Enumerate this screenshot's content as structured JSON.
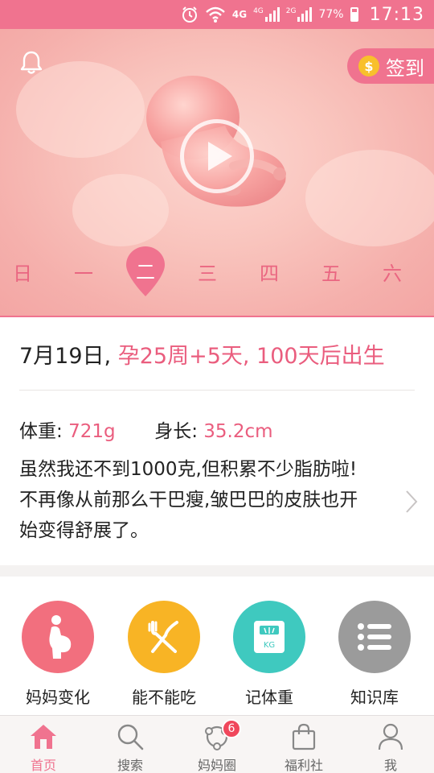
{
  "status_bar": {
    "network_1": "4G",
    "network_2": "4G",
    "network_3": "2G",
    "battery": "77%",
    "time": "17:13"
  },
  "hero": {
    "signin_label": "签到",
    "weekdays": [
      "日",
      "一",
      "二",
      "三",
      "四",
      "五",
      "六"
    ],
    "selected_day": "二"
  },
  "info": {
    "date": "7月19日,",
    "pregnancy": "孕25周+5天, 100天后出生",
    "weight_label": "体重:",
    "weight_value": "721g",
    "length_label": "身长:",
    "length_value": "35.2cm",
    "description": "虽然我还不到1000克,但积累不少脂肪啦!不再像从前那么干巴瘦,皱巴巴的皮肤也开始变得舒展了。"
  },
  "shortcuts": [
    {
      "label": "妈妈变化",
      "icon": "pregnant-woman-icon",
      "color": "#f26f7e"
    },
    {
      "label": "能不能吃",
      "icon": "fork-knife-icon",
      "color": "#f8b425"
    },
    {
      "label": "记体重",
      "icon": "scale-icon",
      "color": "#3fc9bf"
    },
    {
      "label": "知识库",
      "icon": "list-icon",
      "color": "#9b9b9b"
    }
  ],
  "tabs": [
    {
      "label": "首页",
      "icon": "home-icon",
      "active": true
    },
    {
      "label": "搜索",
      "icon": "search-icon"
    },
    {
      "label": "妈妈圈",
      "icon": "circle-icon",
      "badge": "6"
    },
    {
      "label": "福利社",
      "icon": "bag-icon"
    },
    {
      "label": "我",
      "icon": "user-icon"
    }
  ],
  "colors": {
    "brand": "#f0738f",
    "accent_text": "#ea5d7e"
  }
}
